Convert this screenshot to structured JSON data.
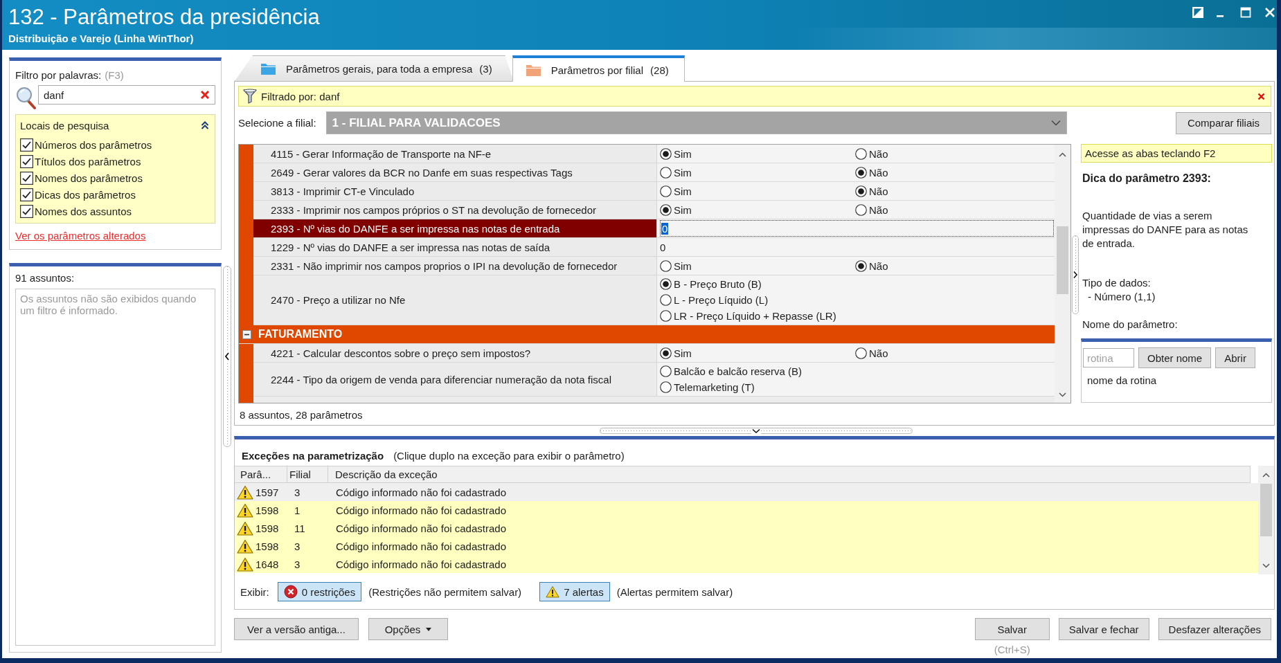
{
  "window": {
    "title": "132 - Parâmetros da presidência",
    "subtitle": "Distribuição e Varejo (Linha WinThor)"
  },
  "filter_panel": {
    "label": "Filtro por palavras:",
    "shortcut": "(F3)",
    "search": {
      "value": "danf"
    },
    "search_locations": {
      "title": "Locais de pesquisa",
      "expanded": true,
      "options": [
        {
          "label": "Números dos parâmetros",
          "checked": true
        },
        {
          "label": "Títulos dos parâmetros",
          "checked": true
        },
        {
          "label": "Nomes dos parâmetros",
          "checked": true
        },
        {
          "label": "Dicas dos parâmetros",
          "checked": true
        },
        {
          "label": "Nomes dos assuntos",
          "checked": true
        }
      ]
    },
    "link": "Ver os parâmetros alterados"
  },
  "subjects_panel": {
    "count": "91 assuntos:",
    "message": "Os assuntos não são exibidos quando um filtro é informado."
  },
  "tabs": [
    {
      "label": "Parâmetros gerais, para toda a empresa",
      "count": "(3)",
      "color": "#3aa6e6",
      "selected": false
    },
    {
      "label": "Parâmetros por filial",
      "count": "(28)",
      "color": "#f2a478",
      "selected": true
    }
  ],
  "filter_bar": {
    "text": "Filtrado por: danf"
  },
  "branch_select": {
    "label": "Selecione a filial:",
    "value": "1 - FILIAL PARA VALIDACOES",
    "disabled": true
  },
  "compare_button": "Comparar filiais",
  "parameters": [
    {
      "kind": "radio",
      "label": "4115 - Gerar Informação de Transporte na NF-e",
      "selected": false,
      "options": [
        {
          "label": "Sim",
          "selected": true
        },
        {
          "label": "Não",
          "selected": false
        }
      ]
    },
    {
      "kind": "radio",
      "label": "2649 - Gerar valores da BCR no Danfe em suas respectivas Tags",
      "selected": false,
      "options": [
        {
          "label": "Sim",
          "selected": false
        },
        {
          "label": "Não",
          "selected": true
        }
      ]
    },
    {
      "kind": "radio",
      "label": "3813 - Imprimir CT-e Vinculado",
      "selected": false,
      "options": [
        {
          "label": "Sim",
          "selected": false
        },
        {
          "label": "Não",
          "selected": true
        }
      ]
    },
    {
      "kind": "radio",
      "label": "2333 - Imprimir nos campos próprios o ST na devolução de fornecedor",
      "selected": false,
      "options": [
        {
          "label": "Sim",
          "selected": true
        },
        {
          "label": "Não",
          "selected": false
        }
      ]
    },
    {
      "kind": "number",
      "label": "2393 - Nº vias do DANFE a ser impressa nas notas de entrada",
      "selected": true,
      "value": "0"
    },
    {
      "kind": "number",
      "label": "1229 - Nº vias do DANFE a ser impressa nas notas de saída",
      "selected": false,
      "value": "0"
    },
    {
      "kind": "radio",
      "label": "2331 - Não imprimir nos campos proprios o IPI na devolução de fornecedor",
      "selected": false,
      "options": [
        {
          "label": "Sim",
          "selected": false
        },
        {
          "label": "Não",
          "selected": true
        }
      ]
    },
    {
      "kind": "list",
      "label": "2470 - Preço a utilizar no Nfe",
      "selected": false,
      "options": [
        {
          "label": "B - Preço Bruto (B)",
          "selected": true
        },
        {
          "label": "L - Preço Líquido (L)",
          "selected": false
        },
        {
          "label": "LR - Preço Líquido + Repasse (LR)",
          "selected": false
        }
      ]
    },
    {
      "kind": "group",
      "label": "FATURAMENTO",
      "expanded": true
    },
    {
      "kind": "radio",
      "label": "4221 - Calcular descontos sobre o preço sem impostos?",
      "selected": false,
      "options": [
        {
          "label": "Sim",
          "selected": true
        },
        {
          "label": "Não",
          "selected": false
        }
      ]
    },
    {
      "kind": "list",
      "label": "2244 - Tipo da origem de venda para diferenciar numeração da nota fiscal",
      "selected": false,
      "options": [
        {
          "label": "Balcão e balcão reserva (B)",
          "selected": false
        },
        {
          "label": "Telemarketing (T)",
          "selected": false
        }
      ]
    }
  ],
  "summary": "8 assuntos, 28 parâmetros",
  "hint_panel": {
    "notice": "Acesse as abas teclando F2",
    "title": "Dica do parâmetro 2393:",
    "description": "Quantidade de vias a serem impressas do DANFE para as notas de entrada.",
    "data_type_label": "Tipo de dados:",
    "data_type": "- Número (1,1)",
    "name_label": "Nome do parâmetro:"
  },
  "routine": {
    "placeholder": "rotina",
    "buttons": [
      "Obter nome",
      "Abrir"
    ],
    "name": "nome da rotina"
  },
  "exceptions": {
    "title": "Exceções na parametrização",
    "hint": "(Clique duplo na exceção para exibir o parâmetro)",
    "columns": [
      "Parâ...",
      "Filial",
      "Descrição da exceção"
    ],
    "rows": [
      {
        "param": "1597",
        "branch": "3",
        "description": "Código informado não foi cadastrado",
        "selected": true
      },
      {
        "param": "1598",
        "branch": "1",
        "description": "Código informado não foi cadastrado",
        "selected": false
      },
      {
        "param": "1598",
        "branch": "11",
        "description": "Código informado não foi cadastrado",
        "selected": false
      },
      {
        "param": "1598",
        "branch": "3",
        "description": "Código informado não foi cadastrado",
        "selected": false
      },
      {
        "param": "1648",
        "branch": "3",
        "description": "Código informado não foi cadastrado",
        "selected": false
      }
    ]
  },
  "display_filter": {
    "label": "Exibir:",
    "toggles": [
      {
        "kind": "restriction",
        "label": "0 restrições",
        "on": true,
        "note": "(Restrições não permitem salvar)"
      },
      {
        "kind": "alert",
        "label": "7 alertas",
        "on": true,
        "note": "(Alertas permitem salvar)"
      }
    ]
  },
  "footer": {
    "left": [
      {
        "kind": "button",
        "label": "Ver a versão antiga..."
      },
      {
        "kind": "menu",
        "label": "Opções"
      }
    ],
    "right": [
      {
        "label": "Salvar",
        "shortcut": "(Ctrl+S)"
      },
      {
        "label": "Salvar e fechar"
      },
      {
        "label": "Desfazer alterações"
      }
    ]
  }
}
